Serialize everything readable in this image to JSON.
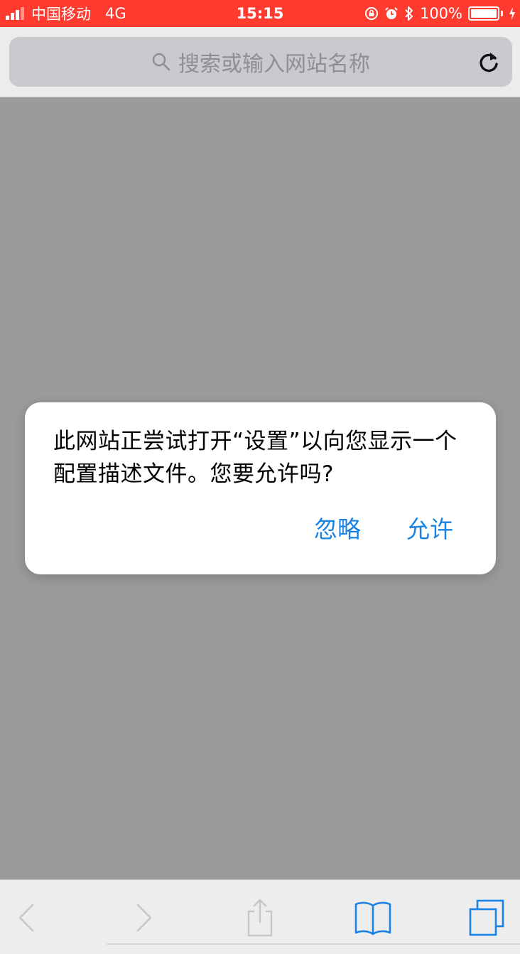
{
  "status_bar": {
    "carrier": "中国移动",
    "network": "4G",
    "time": "15:15",
    "battery_percent": "100%",
    "battery_level": 1.0
  },
  "address_bar": {
    "placeholder": "搜索或输入网站名称"
  },
  "alert": {
    "message": "此网站正尝试打开“设置”以向您显示一个配置描述文件。您要允许吗?",
    "ignore_label": "忽略",
    "allow_label": "允许"
  },
  "colors": {
    "status_bar": "#ff3b30",
    "accent": "#1a82e2",
    "dim_background": "#9b9a9d",
    "disabled_icon": "#c7c7cc"
  },
  "toolbar": {
    "icons": [
      "back-icon",
      "forward-icon",
      "share-icon",
      "bookmarks-icon",
      "tabs-icon"
    ]
  }
}
